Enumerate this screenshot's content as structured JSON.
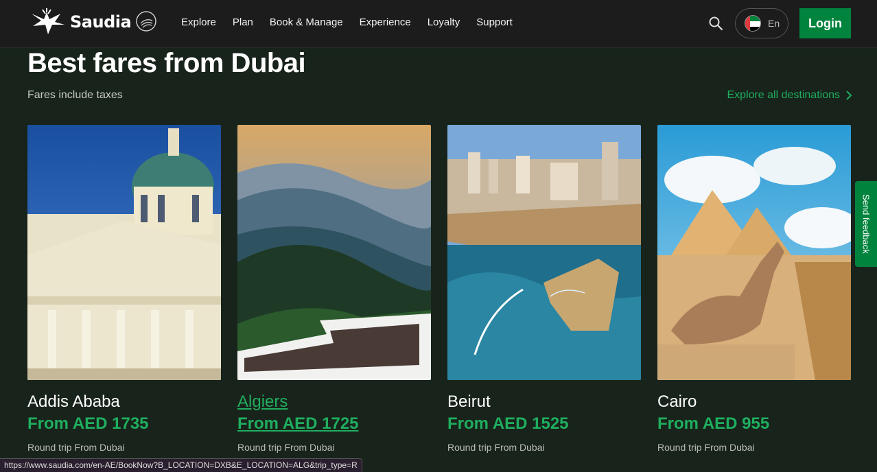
{
  "header": {
    "brand": "Saudia",
    "nav": [
      "Explore",
      "Plan",
      "Book & Manage",
      "Experience",
      "Loyalty",
      "Support"
    ],
    "language": "En",
    "login_label": "Login"
  },
  "section": {
    "title": "Best fares from Dubai",
    "subtitle": "Fares include taxes",
    "explore_link": "Explore all destinations"
  },
  "cards": [
    {
      "city": "Addis Ababa",
      "price": "From AED 1735",
      "trip": "Round trip From Dubai"
    },
    {
      "city": "Algiers",
      "price": "From AED 1725",
      "trip": "Round trip From Dubai"
    },
    {
      "city": "Beirut",
      "price": "From AED 1525",
      "trip": "Round trip From Dubai"
    },
    {
      "city": "Cairo",
      "price": "From AED 955",
      "trip": "Round trip From Dubai"
    }
  ],
  "feedback_label": "Send feedback",
  "status_url": "https://www.saudia.com/en-AE/BookNow?B_LOCATION=DXB&E_LOCATION=ALG&trip_type=R",
  "colors": {
    "brand_green": "#00843d",
    "accent_green": "#1fae5f",
    "background": "#18241b",
    "navbar": "#1c1c1c"
  },
  "icons": [
    "saudia-logo",
    "skyteam-icon",
    "search-icon",
    "uae-flag-icon",
    "chevron-right-icon"
  ]
}
